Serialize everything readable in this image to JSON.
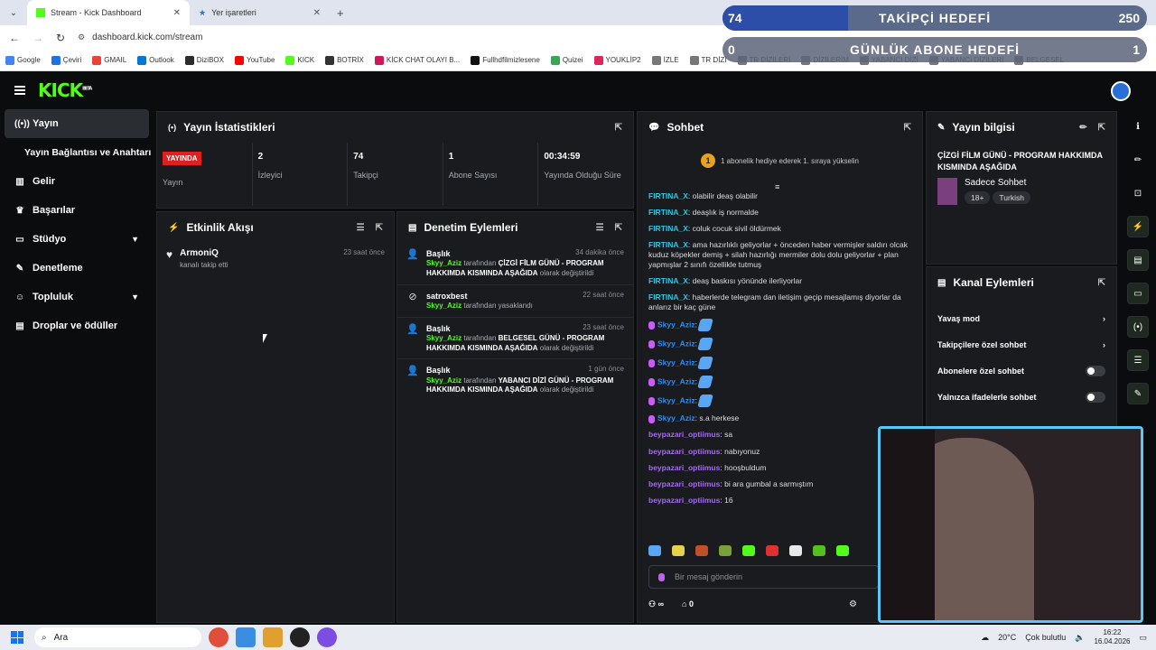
{
  "browser": {
    "tabs": [
      {
        "label": "Stream - Kick Dashboard",
        "active": true
      },
      {
        "label": "Yer işaretleri",
        "active": false
      }
    ],
    "new_tab": "+",
    "url": "dashboard.kick.com/stream",
    "bookmarks": [
      {
        "label": "Google",
        "color": "#4285f4"
      },
      {
        "label": "Çeviri",
        "color": "#1a73e8"
      },
      {
        "label": "GMAIL",
        "color": "#ea4335"
      },
      {
        "label": "Outlook",
        "color": "#0078d4"
      },
      {
        "label": "DiziBOX",
        "color": "#2b2b2b"
      },
      {
        "label": "YouTube",
        "color": "#ff0000"
      },
      {
        "label": "KICK",
        "color": "#53fc18"
      },
      {
        "label": "BOTRİX",
        "color": "#333"
      },
      {
        "label": "KİCK CHAT OLAYI B...",
        "color": "#d4145a"
      },
      {
        "label": "Fullhdfilmizlesene",
        "color": "#111"
      },
      {
        "label": "Quizei",
        "color": "#3aa757"
      },
      {
        "label": "YOUKLİP2",
        "color": "#e0245e"
      },
      {
        "label": "İZLE",
        "color": "#777"
      },
      {
        "label": "TR DİZİ",
        "color": "#777"
      },
      {
        "label": "TR DİZİLERİ",
        "color": "#777"
      },
      {
        "label": "DİZİLERİM",
        "color": "#777"
      },
      {
        "label": "YABANCI DİZİ",
        "color": "#777"
      },
      {
        "label": "YABANCI DİZİLERİ",
        "color": "#777"
      },
      {
        "label": "BELGESEL",
        "color": "#777"
      }
    ]
  },
  "overlays": {
    "follower_goal": {
      "current": "74",
      "title": "TAKİPÇİ HEDEFİ",
      "target": "250",
      "progress": 0.296
    },
    "sub_goal": {
      "current": "0",
      "title": "GÜNLÜK ABONE HEDEFİ",
      "target": "1",
      "progress": 0
    }
  },
  "app": {
    "logo": "KICK",
    "logo_badge": "BETA"
  },
  "sidebar": {
    "items": [
      {
        "label": "Yayın",
        "icon": "broadcast-icon"
      },
      {
        "label": "Yayın Bağlantısı ve Anahtarı",
        "icon": ""
      },
      {
        "label": "Gelir",
        "icon": "revenue-icon"
      },
      {
        "label": "Başarılar",
        "icon": "trophy-icon"
      },
      {
        "label": "Stüdyo",
        "icon": "studio-icon"
      },
      {
        "label": "Denetleme",
        "icon": "wrench-icon"
      },
      {
        "label": "Topluluk",
        "icon": "community-icon"
      },
      {
        "label": "Droplar ve ödüller",
        "icon": "drops-icon"
      }
    ]
  },
  "stats": {
    "title": "Yayın İstatistikleri",
    "status_badge": "YAYINDA",
    "status_label": "Yayın",
    "items": [
      {
        "value": "2",
        "label": "İzleyici"
      },
      {
        "value": "74",
        "label": "Takipçi"
      },
      {
        "value": "1",
        "label": "Abone Sayısı"
      },
      {
        "value": "00:34:59",
        "label": "Yayında Olduğu Süre"
      }
    ]
  },
  "activity": {
    "title": "Etkinlik Akışı",
    "items": [
      {
        "user": "ArmoniQ",
        "text": "kanalı takip etti",
        "time": "23 saat önce"
      }
    ]
  },
  "moderation": {
    "title": "Denetim Eylemleri",
    "items": [
      {
        "title": "Başlık",
        "time": "34 dakika önce",
        "user": "Skyy_Aziz",
        "mid": "tarafından",
        "value": "ÇİZGİ FİLM GÜNÜ - PROGRAM HAKKIMDA KISMINDA AŞAĞIDA",
        "tail": "olarak değiştirildi"
      },
      {
        "title": "satroxbest",
        "time": "22 saat önce",
        "user": "Skyy_Aziz",
        "mid": "tarafından yasaklandı",
        "value": "",
        "tail": ""
      },
      {
        "title": "Başlık",
        "time": "23 saat önce",
        "user": "Skyy_Aziz",
        "mid": "tarafından",
        "value": "BELGESEL GÜNÜ - PROGRAM HAKKIMDA KISMINDA AŞAĞIDA",
        "tail": "olarak değiştirildi"
      },
      {
        "title": "Başlık",
        "time": "1 gün önce",
        "user": "Skyy_Aziz",
        "mid": "tarafından",
        "value": "YABANCI DİZİ GÜNÜ - PROGRAM HAKKIMDA KISMINDA AŞAĞIDA",
        "tail": "olarak değiştirildi"
      }
    ]
  },
  "chat": {
    "title": "Sohbet",
    "banner": "1 abonelik hediye ederek 1. sıraya yükselin",
    "rank": "1",
    "messages": [
      {
        "user": "FIRTINA_X",
        "text": "olabilir deaş olabilir"
      },
      {
        "user": "FIRTINA_X",
        "text": "deaşlık iş normalde"
      },
      {
        "user": "FIRTINA_X",
        "text": "coluk cocuk sivil öldürmek"
      },
      {
        "user": "FIRTINA_X",
        "text": "ama hazırlıklı geliyorlar + önceden haber vermişler saldırı olcak kuduz köpekler demiş + silah hazırlığı mermiler dolu dolu geliyorlar + plan yapmışlar 2 sınıfı özellikle tutmuş"
      },
      {
        "user": "FIRTINA_X",
        "text": "deaş baskısı yönünde ilerliyorlar"
      },
      {
        "user": "FIRTINA_X",
        "text": "haberlerde telegram dan iletişim geçip mesajlamış diyorlar da anlarız bir kaç güne"
      },
      {
        "user": "Skyy_Aziz",
        "text": "",
        "emote": true
      },
      {
        "user": "Skyy_Aziz",
        "text": "",
        "emote": true
      },
      {
        "user": "Skyy_Aziz",
        "text": "",
        "emote": true
      },
      {
        "user": "Skyy_Aziz",
        "text": "",
        "emote": true
      },
      {
        "user": "Skyy_Aziz",
        "text": "",
        "emote": true
      },
      {
        "user": "Skyy_Aziz",
        "text": "s.a herkese"
      },
      {
        "user": "beypazari_optiimus",
        "text": "sa"
      },
      {
        "user": "beypazari_optiimus",
        "text": "nabıyonuz"
      },
      {
        "user": "beypazari_optiimus",
        "text": "hooşbuldum"
      },
      {
        "user": "beypazari_optiimus",
        "text": "bi ara gumbal a sarmıştım"
      },
      {
        "user": "beypazari_optiimus",
        "text": "16"
      }
    ],
    "input_placeholder": "Bir mesaj gönderin",
    "points": "∞",
    "gifts": "0"
  },
  "stream_info": {
    "title": "Yayın bilgisi",
    "stream_title": "ÇİZGİ FİLM GÜNÜ - PROGRAM HAKKIMDA KISMINDA AŞAĞIDA",
    "category": "Sadece Sohbet",
    "tags": [
      "18+",
      "Turkish"
    ]
  },
  "channel_actions": {
    "title": "Kanal Eylemleri",
    "items": [
      {
        "label": "Yavaş mod",
        "control": "chevron"
      },
      {
        "label": "Takipçilere özel sohbet",
        "control": "chevron"
      },
      {
        "label": "Abonelere özel sohbet",
        "control": "toggle"
      },
      {
        "label": "Yalnızca ifadelerle sohbet",
        "control": "toggle"
      }
    ]
  },
  "taskbar": {
    "search": "Ara",
    "weather": "20°C",
    "weather_text": "Çok bulutlu",
    "time": "16:22",
    "date": "16.04.2026"
  }
}
